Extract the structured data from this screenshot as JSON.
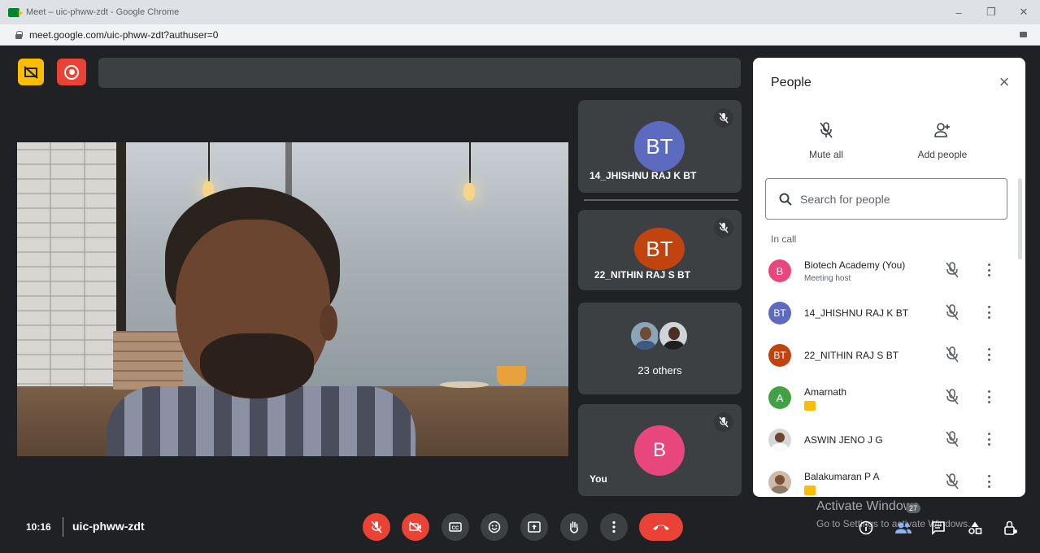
{
  "browser": {
    "title": "Meet – uic-phww-zdt - Google Chrome",
    "url": "meet.google.com/uic-phww-zdt?authuser=0",
    "controls": [
      "–",
      "❐",
      "✕"
    ]
  },
  "panel": {
    "title": "People",
    "actions": {
      "mute_all": "Mute all",
      "add_people": "Add people"
    },
    "search_placeholder": "Search for people",
    "section": "In call",
    "participants": [
      {
        "initials": "B",
        "name": "Biotech Academy (You)",
        "sub": "Meeting host",
        "color": "#e8477e"
      },
      {
        "initials": "BT",
        "name": "14_JHISHNU RAJ K BT",
        "sub": "",
        "color": "#5c6bc0"
      },
      {
        "initials": "BT",
        "name": "22_NITHIN RAJ S BT",
        "sub": "",
        "color": "#c1440e"
      },
      {
        "initials": "A",
        "name": "Amarnath",
        "sub": "",
        "color": "#43a047"
      },
      {
        "initials": "",
        "name": "ASWIN JENO J G",
        "sub": "",
        "color": "#9e9e9e"
      },
      {
        "initials": "",
        "name": "Balakumaran P A",
        "sub": "",
        "color": "#a1887f"
      }
    ]
  },
  "tiles": [
    {
      "initials": "BT",
      "name": "14_JHISHNU RAJ K BT",
      "color": "#5c6bc0"
    },
    {
      "initials": "BT",
      "name": "22_NITHIN RAJ S BT",
      "color": "#c1440e"
    },
    {
      "name": "23 others"
    },
    {
      "initials": "B",
      "name": "You",
      "color": "#e8477e"
    }
  ],
  "bottom": {
    "time": "10:16",
    "meeting_code": "uic-phww-zdt",
    "people_count": "27"
  },
  "watermark": {
    "line1": "Activate Windows",
    "line2": "Go to Settings to activate Windows."
  },
  "colors": {
    "accent_red": "#ea4335",
    "accent_yellow": "#fbbc04",
    "panel_bg": "#ffffff",
    "stage_bg": "#202124"
  }
}
